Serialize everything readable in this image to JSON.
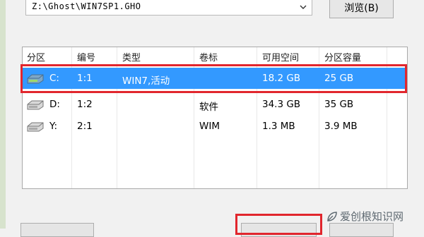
{
  "image_path": {
    "value": "Z:\\Ghost\\WIN7SP1.GHO",
    "browse_label": "浏览(B)"
  },
  "partition_table": {
    "headers": [
      "分区",
      "编号",
      "类型",
      "卷标",
      "可用空间",
      "分区容量"
    ],
    "rows": [
      {
        "drive": "C:",
        "number": "1:1",
        "type": "WIN7,活动",
        "label": "",
        "free": "18.2 GB",
        "size": "25 GB",
        "selected": true
      },
      {
        "drive": "D:",
        "number": "1:2",
        "type": "",
        "label": "软件",
        "free": "34.3 GB",
        "size": "35 GB",
        "selected": false
      },
      {
        "drive": "Y:",
        "number": "2:1",
        "type": "",
        "label": "WIM",
        "free": "1.3 MB",
        "size": "3.9 MB",
        "selected": false
      }
    ]
  },
  "watermark": {
    "text": "爱创根知识网"
  },
  "colors": {
    "selection": "#3399ff",
    "highlight_box": "#e1262d"
  }
}
